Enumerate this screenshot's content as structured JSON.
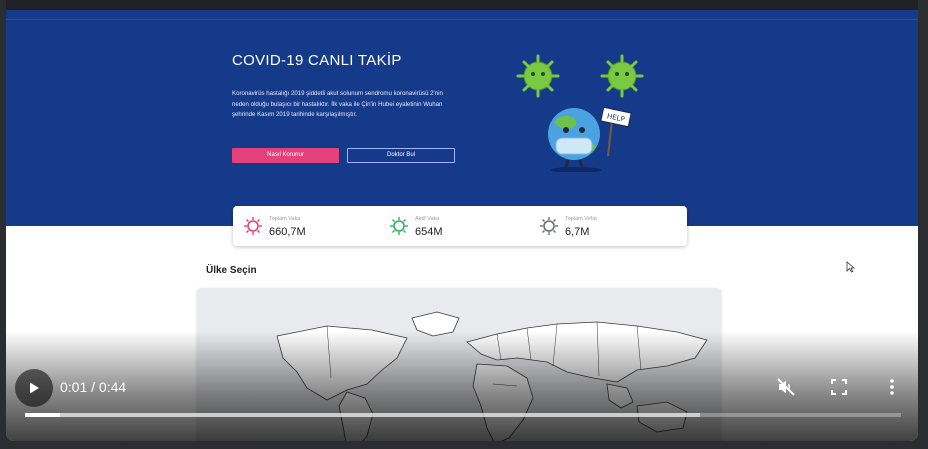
{
  "hero": {
    "title": "COVID-19 CANLI TAKİP",
    "description": "Koronavirüs hastalığı 2019 şiddetli akut solunum sendromu koronavirüsü 2'nin neden olduğu bulaşıcı bir hastalıktır. İlk vaka ile Çin'in Hubei eyaletinin Wuhan şehrinde Kasım 2019 tarihinde karşılaşılmıştır.",
    "primary_button": "Nasıl Korunur",
    "secondary_button": "Doktor Bul",
    "illustration_sign": "HELP"
  },
  "stats": [
    {
      "label": "Toplam Vaka",
      "value": "660,7M",
      "color": "#e4407a"
    },
    {
      "label": "Aktif Vaka",
      "value": "654M",
      "color": "#27b35a"
    },
    {
      "label": "Toplam Vefat",
      "value": "6,7M",
      "color": "#6b6f75"
    }
  ],
  "section": {
    "title": "Ülke Seçin"
  },
  "player": {
    "time": "0:01 / 0:44",
    "progress": 0.04,
    "buffered": 0.77,
    "icons": [
      "play-icon",
      "mute-icon",
      "fullscreen-icon",
      "more-icon"
    ]
  },
  "colors": {
    "hero_bg": "#163a8a",
    "accent": "#e4407a"
  }
}
